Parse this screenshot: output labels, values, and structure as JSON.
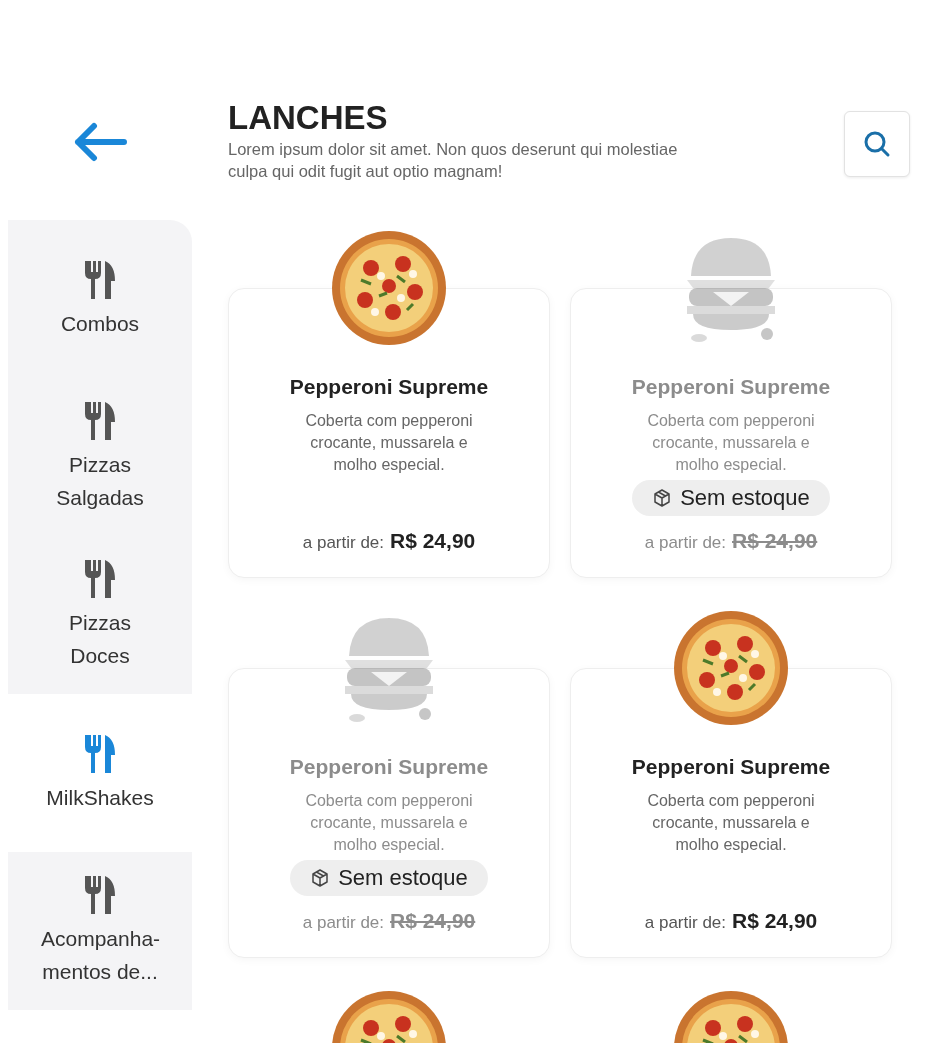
{
  "header": {
    "title": "LANCHES",
    "subtitle": "Lorem ipsum dolor sit amet. Non quos deserunt qui molestiae culpa qui odit fugit aut optio magnam!"
  },
  "sidebar": {
    "items": [
      {
        "label": "Combos",
        "selected": false
      },
      {
        "label": "Pizzas Salgadas",
        "selected": false
      },
      {
        "label": "Pizzas Doces",
        "selected": false
      },
      {
        "label": "MilkShakes",
        "selected": true
      },
      {
        "label": "Acompanha-mentos de...",
        "selected": false
      }
    ]
  },
  "products": [
    {
      "kind": "pizza",
      "name": "Pepperoni Supreme",
      "description": "Coberta com pepperoni crocante, mussarela e molho especial.",
      "price_label": "a partir de:",
      "price": "R$ 24,90",
      "in_stock": true
    },
    {
      "kind": "burger",
      "name": "Pepperoni Supreme",
      "description": "Coberta com pepperoni crocante, mussarela e molho especial.",
      "price_label": "a partir de:",
      "price": "R$ 24,90",
      "in_stock": false,
      "badge": "Sem estoque"
    },
    {
      "kind": "burger",
      "name": "Pepperoni Supreme",
      "description": "Coberta com pepperoni crocante, mussarela e molho especial.",
      "price_label": "a partir de:",
      "price": "R$ 24,90",
      "in_stock": false,
      "badge": "Sem estoque"
    },
    {
      "kind": "pizza",
      "name": "Pepperoni Supreme",
      "description": "Coberta com pepperoni crocante, mussarela e molho especial.",
      "price_label": "a partir de:",
      "price": "R$ 24,90",
      "in_stock": true
    },
    {
      "kind": "pizza"
    },
    {
      "kind": "pizza"
    }
  ]
}
